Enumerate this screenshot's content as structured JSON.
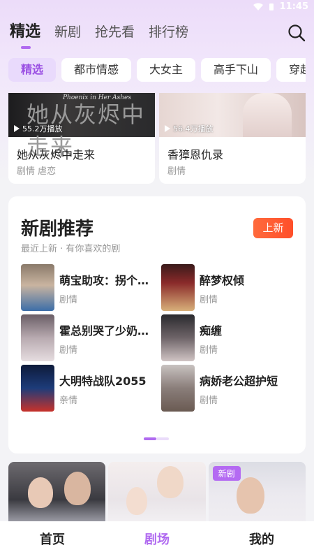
{
  "status": {
    "time": "11:45"
  },
  "top_tabs": [
    {
      "label": "精选"
    },
    {
      "label": "新剧"
    },
    {
      "label": "抢先看"
    },
    {
      "label": "排行榜"
    }
  ],
  "chips": [
    "精选",
    "都市情感",
    "大女主",
    "高手下山",
    "穿越"
  ],
  "hero_cards": [
    {
      "plays": "55.2万播放",
      "title": "她从灰烬中走来",
      "tags": "剧情 虐恋",
      "poster_text": "她从灰烬中走来",
      "poster_en": "Phoenix in Her Ashes"
    },
    {
      "plays": "56.4万播放",
      "title": "香獐恩仇录",
      "tags": "剧情"
    }
  ],
  "new_dramas": {
    "title": "新剧推荐",
    "subtitle": "最近上新 · 有你喜欢的剧",
    "badge": "上新",
    "items": [
      {
        "title": "萌宝助攻：拐个…",
        "genre": "剧情"
      },
      {
        "title": "醉梦权倾",
        "genre": "剧情"
      },
      {
        "title": "霍总别哭了少奶…",
        "genre": "剧情"
      },
      {
        "title": "痴缠",
        "genre": "剧情"
      },
      {
        "title": "大明特战队2055",
        "genre": "亲情"
      },
      {
        "title": "病娇老公超护短",
        "genre": "剧情"
      }
    ]
  },
  "bottom_cards": [
    {
      "badge": ""
    },
    {
      "badge": ""
    },
    {
      "badge": "新剧"
    }
  ],
  "bottom_nav": [
    {
      "label": "首页"
    },
    {
      "label": "剧场"
    },
    {
      "label": "我的"
    }
  ],
  "colors": {
    "accent": "#b06af0",
    "badge_orange": "#ff5a33",
    "chip_active_bg": "#e9dafc"
  }
}
